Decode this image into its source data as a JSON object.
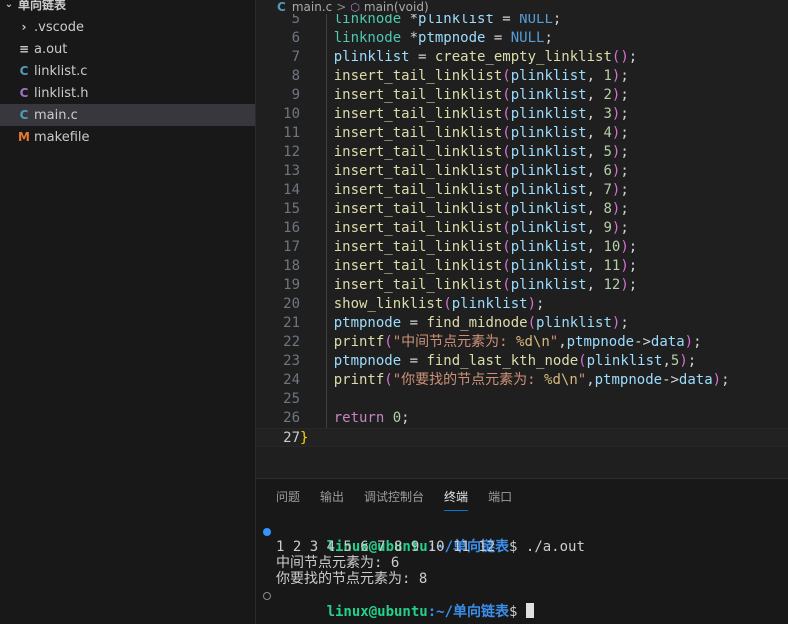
{
  "explorer": {
    "folder_name": "单向链表",
    "files": [
      {
        "name": ".vscode",
        "icon": "chevron-right-icon",
        "glyph": "›",
        "color": "#cccccc"
      },
      {
        "name": "a.out",
        "icon": "lines-file-icon",
        "glyph": "≡",
        "color": "#cccccc"
      },
      {
        "name": "linklist.c",
        "icon": "c-file-icon",
        "glyph": "C",
        "color": "#519aba"
      },
      {
        "name": "linklist.h",
        "icon": "c-header-file-icon",
        "glyph": "C",
        "color": "#a074c4"
      },
      {
        "name": "main.c",
        "icon": "c-file-icon",
        "glyph": "C",
        "color": "#519aba",
        "selected": true
      },
      {
        "name": "makefile",
        "icon": "makefile-icon",
        "glyph": "M",
        "color": "#e37933"
      }
    ]
  },
  "breadcrumb": {
    "file": "main.c",
    "separator": ">",
    "symbol": "main(void)"
  },
  "editor": {
    "current_line": 27,
    "lines": [
      {
        "n": "5",
        "tokens": [
          [
            "ty",
            "    linknode"
          ],
          [
            "op",
            " *"
          ],
          [
            "var",
            "plinklist"
          ],
          [
            "op",
            " = "
          ],
          [
            "nul",
            "NULL"
          ],
          [
            "op",
            ";"
          ]
        ]
      },
      {
        "n": "6",
        "tokens": [
          [
            "ty",
            "    linknode"
          ],
          [
            "op",
            " *"
          ],
          [
            "var",
            "ptmpnode"
          ],
          [
            "op",
            " = "
          ],
          [
            "nul",
            "NULL"
          ],
          [
            "op",
            ";"
          ]
        ]
      },
      {
        "n": "7",
        "tokens": [
          [
            "var",
            "    plinklist"
          ],
          [
            "op",
            " = "
          ],
          [
            "fn",
            "create_empty_linklist"
          ],
          [
            "p2",
            "()"
          ],
          [
            "op",
            ";"
          ]
        ]
      },
      {
        "n": "8",
        "tokens": [
          [
            "fn",
            "    insert_tail_linklist"
          ],
          [
            "p2",
            "("
          ],
          [
            "var",
            "plinklist"
          ],
          [
            "op",
            ", "
          ],
          [
            "num",
            "1"
          ],
          [
            "p2",
            ")"
          ],
          [
            "op",
            ";"
          ]
        ]
      },
      {
        "n": "9",
        "tokens": [
          [
            "fn",
            "    insert_tail_linklist"
          ],
          [
            "p2",
            "("
          ],
          [
            "var",
            "plinklist"
          ],
          [
            "op",
            ", "
          ],
          [
            "num",
            "2"
          ],
          [
            "p2",
            ")"
          ],
          [
            "op",
            ";"
          ]
        ]
      },
      {
        "n": "10",
        "tokens": [
          [
            "fn",
            "    insert_tail_linklist"
          ],
          [
            "p2",
            "("
          ],
          [
            "var",
            "plinklist"
          ],
          [
            "op",
            ", "
          ],
          [
            "num",
            "3"
          ],
          [
            "p2",
            ")"
          ],
          [
            "op",
            ";"
          ]
        ]
      },
      {
        "n": "11",
        "tokens": [
          [
            "fn",
            "    insert_tail_linklist"
          ],
          [
            "p2",
            "("
          ],
          [
            "var",
            "plinklist"
          ],
          [
            "op",
            ", "
          ],
          [
            "num",
            "4"
          ],
          [
            "p2",
            ")"
          ],
          [
            "op",
            ";"
          ]
        ]
      },
      {
        "n": "12",
        "tokens": [
          [
            "fn",
            "    insert_tail_linklist"
          ],
          [
            "p2",
            "("
          ],
          [
            "var",
            "plinklist"
          ],
          [
            "op",
            ", "
          ],
          [
            "num",
            "5"
          ],
          [
            "p2",
            ")"
          ],
          [
            "op",
            ";"
          ]
        ]
      },
      {
        "n": "13",
        "tokens": [
          [
            "fn",
            "    insert_tail_linklist"
          ],
          [
            "p2",
            "("
          ],
          [
            "var",
            "plinklist"
          ],
          [
            "op",
            ", "
          ],
          [
            "num",
            "6"
          ],
          [
            "p2",
            ")"
          ],
          [
            "op",
            ";"
          ]
        ]
      },
      {
        "n": "14",
        "tokens": [
          [
            "fn",
            "    insert_tail_linklist"
          ],
          [
            "p2",
            "("
          ],
          [
            "var",
            "plinklist"
          ],
          [
            "op",
            ", "
          ],
          [
            "num",
            "7"
          ],
          [
            "p2",
            ")"
          ],
          [
            "op",
            ";"
          ]
        ]
      },
      {
        "n": "15",
        "tokens": [
          [
            "fn",
            "    insert_tail_linklist"
          ],
          [
            "p2",
            "("
          ],
          [
            "var",
            "plinklist"
          ],
          [
            "op",
            ", "
          ],
          [
            "num",
            "8"
          ],
          [
            "p2",
            ")"
          ],
          [
            "op",
            ";"
          ]
        ]
      },
      {
        "n": "16",
        "tokens": [
          [
            "fn",
            "    insert_tail_linklist"
          ],
          [
            "p2",
            "("
          ],
          [
            "var",
            "plinklist"
          ],
          [
            "op",
            ", "
          ],
          [
            "num",
            "9"
          ],
          [
            "p2",
            ")"
          ],
          [
            "op",
            ";"
          ]
        ]
      },
      {
        "n": "17",
        "tokens": [
          [
            "fn",
            "    insert_tail_linklist"
          ],
          [
            "p2",
            "("
          ],
          [
            "var",
            "plinklist"
          ],
          [
            "op",
            ", "
          ],
          [
            "num",
            "10"
          ],
          [
            "p2",
            ")"
          ],
          [
            "op",
            ";"
          ]
        ]
      },
      {
        "n": "18",
        "tokens": [
          [
            "fn",
            "    insert_tail_linklist"
          ],
          [
            "p2",
            "("
          ],
          [
            "var",
            "plinklist"
          ],
          [
            "op",
            ", "
          ],
          [
            "num",
            "11"
          ],
          [
            "p2",
            ")"
          ],
          [
            "op",
            ";"
          ]
        ]
      },
      {
        "n": "19",
        "tokens": [
          [
            "fn",
            "    insert_tail_linklist"
          ],
          [
            "p2",
            "("
          ],
          [
            "var",
            "plinklist"
          ],
          [
            "op",
            ", "
          ],
          [
            "num",
            "12"
          ],
          [
            "p2",
            ")"
          ],
          [
            "op",
            ";"
          ]
        ]
      },
      {
        "n": "20",
        "tokens": [
          [
            "fn",
            "    show_linklist"
          ],
          [
            "p2",
            "("
          ],
          [
            "var",
            "plinklist"
          ],
          [
            "p2",
            ")"
          ],
          [
            "op",
            ";"
          ]
        ]
      },
      {
        "n": "21",
        "tokens": [
          [
            "var",
            "    ptmpnode"
          ],
          [
            "op",
            " = "
          ],
          [
            "fn",
            "find_midnode"
          ],
          [
            "p2",
            "("
          ],
          [
            "var",
            "plinklist"
          ],
          [
            "p2",
            ")"
          ],
          [
            "op",
            ";"
          ]
        ]
      },
      {
        "n": "22",
        "tokens": [
          [
            "fn",
            "    printf"
          ],
          [
            "p2",
            "("
          ],
          [
            "str",
            "\"中间节点元素为: "
          ],
          [
            "esc",
            "%d\\n"
          ],
          [
            "str",
            "\""
          ],
          [
            "op",
            ","
          ],
          [
            "var",
            "ptmpnode"
          ],
          [
            "op",
            "->"
          ],
          [
            "var",
            "data"
          ],
          [
            "p2",
            ")"
          ],
          [
            "op",
            ";"
          ]
        ]
      },
      {
        "n": "23",
        "tokens": [
          [
            "var",
            "    ptmpnode"
          ],
          [
            "op",
            " = "
          ],
          [
            "fn",
            "find_last_kth_node"
          ],
          [
            "p2",
            "("
          ],
          [
            "var",
            "plinklist"
          ],
          [
            "op",
            ","
          ],
          [
            "num",
            "5"
          ],
          [
            "p2",
            ")"
          ],
          [
            "op",
            ";"
          ]
        ]
      },
      {
        "n": "24",
        "tokens": [
          [
            "fn",
            "    printf"
          ],
          [
            "p2",
            "("
          ],
          [
            "str",
            "\"你要找的节点元素为: "
          ],
          [
            "esc",
            "%d\\n"
          ],
          [
            "str",
            "\""
          ],
          [
            "op",
            ","
          ],
          [
            "var",
            "ptmpnode"
          ],
          [
            "op",
            "->"
          ],
          [
            "var",
            "data"
          ],
          [
            "p2",
            ")"
          ],
          [
            "op",
            ";"
          ]
        ]
      },
      {
        "n": "25",
        "tokens": []
      },
      {
        "n": "26",
        "tokens": [
          [
            "kw",
            "    return"
          ],
          [
            "op",
            " "
          ],
          [
            "num",
            "0"
          ],
          [
            "op",
            ";"
          ]
        ]
      },
      {
        "n": "27",
        "tokens": [
          [
            "p1",
            "}"
          ]
        ]
      }
    ]
  },
  "panel": {
    "tabs": [
      {
        "label": "问题",
        "active": false
      },
      {
        "label": "输出",
        "active": false
      },
      {
        "label": "调试控制台",
        "active": false
      },
      {
        "label": "终端",
        "active": true
      },
      {
        "label": "端口",
        "active": false
      }
    ]
  },
  "terminal": {
    "prompt_user": "linux@ubuntu",
    "prompt_path": ":~/单向链表",
    "prompt_symbol": "$",
    "command": " ./a.out",
    "output": [
      "1 2 3 4 5 6 7 8 9 10 11 12",
      "中间节点元素为: 6",
      "你要找的节点元素为: 8"
    ]
  },
  "colors": {
    "accent": "#0078d4",
    "prompt_user": "#23d18b",
    "prompt_path": "#3b8eea",
    "status_dot": "#3794ff"
  }
}
